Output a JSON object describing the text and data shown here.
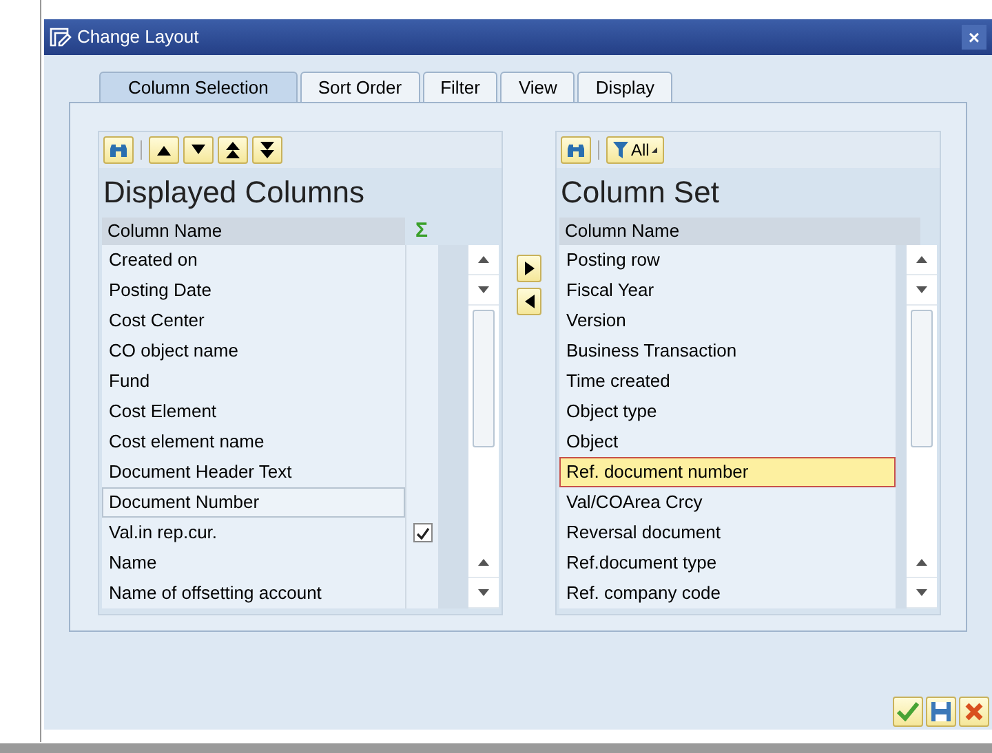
{
  "window": {
    "title": "Change Layout",
    "close": "×"
  },
  "tabs": [
    {
      "label": "Column Selection",
      "selected": true
    },
    {
      "label": "Sort Order",
      "selected": false
    },
    {
      "label": "Filter",
      "selected": false
    },
    {
      "label": "View",
      "selected": false
    },
    {
      "label": "Display",
      "selected": false
    }
  ],
  "displayed_columns": {
    "title": "Displayed Columns",
    "header": "Column Name",
    "sum_header": "Σ",
    "rows": [
      {
        "name": "Created on",
        "focused": false,
        "checked": false
      },
      {
        "name": "Posting Date",
        "focused": false,
        "checked": false
      },
      {
        "name": "Cost Center",
        "focused": false,
        "checked": false
      },
      {
        "name": "CO object name",
        "focused": false,
        "checked": false
      },
      {
        "name": "Fund",
        "focused": false,
        "checked": false
      },
      {
        "name": "Cost Element",
        "focused": false,
        "checked": false
      },
      {
        "name": "Cost element name",
        "focused": false,
        "checked": false
      },
      {
        "name": "Document Header Text",
        "focused": false,
        "checked": false
      },
      {
        "name": "Document Number",
        "focused": true,
        "checked": false
      },
      {
        "name": "Val.in rep.cur.",
        "focused": false,
        "checked": true
      },
      {
        "name": "Name",
        "focused": false,
        "checked": false
      },
      {
        "name": "Name of offsetting account",
        "focused": false,
        "checked": false
      }
    ]
  },
  "column_set": {
    "title": "Column Set",
    "filter_button": "All",
    "header": "Column Name",
    "rows": [
      {
        "name": "Posting row",
        "selected": false
      },
      {
        "name": "Fiscal Year",
        "selected": false
      },
      {
        "name": "Version",
        "selected": false
      },
      {
        "name": "Business Transaction",
        "selected": false
      },
      {
        "name": "Time created",
        "selected": false
      },
      {
        "name": "Object type",
        "selected": false
      },
      {
        "name": "Object",
        "selected": false
      },
      {
        "name": "Ref. document number",
        "selected": true
      },
      {
        "name": "Val/COArea Crcy",
        "selected": false
      },
      {
        "name": "Reversal document",
        "selected": false
      },
      {
        "name": "Ref.document type",
        "selected": false
      },
      {
        "name": "Ref. company code",
        "selected": false
      }
    ]
  }
}
